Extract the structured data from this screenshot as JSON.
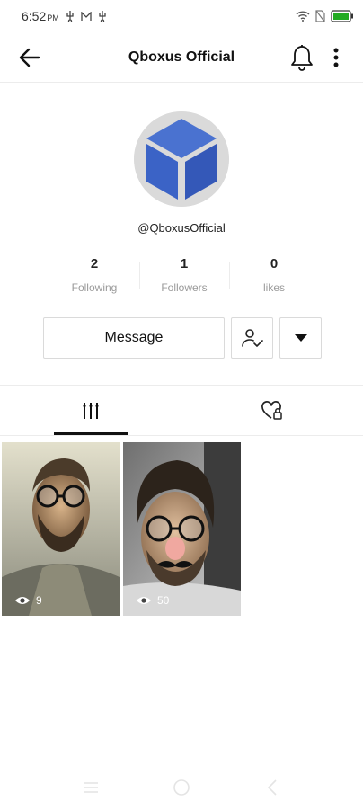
{
  "status_bar": {
    "time": "6:52",
    "ampm": "PM",
    "icons": [
      "usb-icon",
      "mail-icon",
      "usb-icon",
      "wifi-icon",
      "no-sim-icon",
      "battery-icon"
    ]
  },
  "header": {
    "title": "Qboxus Official",
    "icons": [
      "back-arrow-icon",
      "bell-icon",
      "more-vertical-icon"
    ]
  },
  "profile": {
    "username": "@QboxusOfficial",
    "stats": [
      {
        "value": "2",
        "label": "Following"
      },
      {
        "value": "1",
        "label": "Followers"
      },
      {
        "value": "0",
        "label": "likes"
      }
    ]
  },
  "actions": {
    "message_label": "Message",
    "follow_icon": "user-check-icon",
    "dropdown_icon": "caret-down-icon"
  },
  "tabs": [
    {
      "name": "videos",
      "icon": "grid-bars-icon",
      "active": true
    },
    {
      "name": "liked",
      "icon": "heart-lock-icon",
      "active": false
    }
  ],
  "videos": [
    {
      "views": "9"
    },
    {
      "views": "50"
    }
  ],
  "colors": {
    "accent": "#111111",
    "avatar_blue": "#3b63c6",
    "muted": "#9a9a9a",
    "battery": "#22aa22"
  }
}
